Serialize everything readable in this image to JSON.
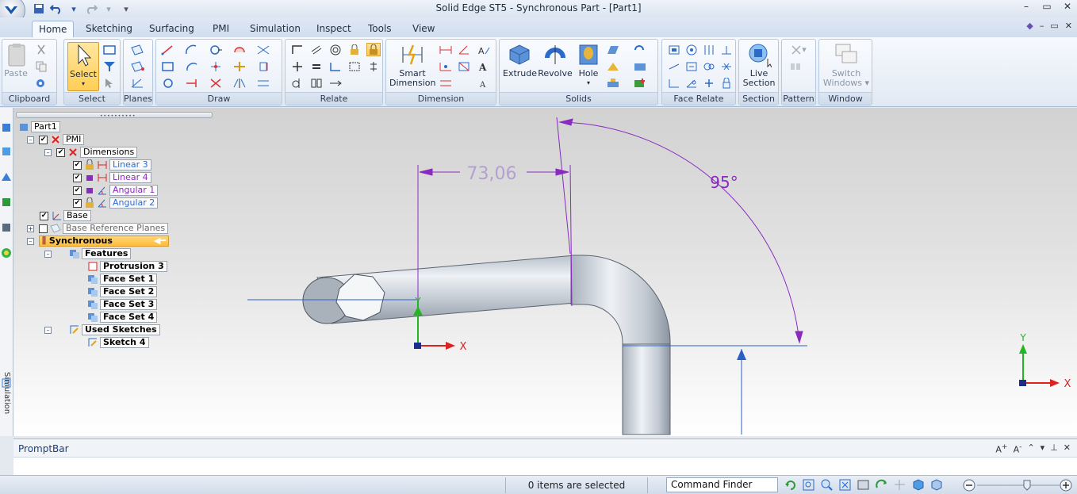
{
  "window": {
    "title": "Solid Edge ST5 - Synchronous Part - [Part1]"
  },
  "tabs": [
    {
      "label": "Home",
      "active": true
    },
    {
      "label": "Sketching"
    },
    {
      "label": "Surfacing"
    },
    {
      "label": "PMI"
    },
    {
      "label": "Simulation"
    },
    {
      "label": "Inspect"
    },
    {
      "label": "Tools"
    },
    {
      "label": "View"
    }
  ],
  "ribbon": {
    "clipboard": {
      "label": "Clipboard",
      "paste": "Paste"
    },
    "select": {
      "label": "Select",
      "select": "Select"
    },
    "planes": {
      "label": "Planes"
    },
    "draw": {
      "label": "Draw"
    },
    "relate": {
      "label": "Relate"
    },
    "dimension": {
      "label": "Dimension",
      "smart_1": "Smart",
      "smart_2": "Dimension"
    },
    "solids": {
      "label": "Solids",
      "extrude": "Extrude",
      "revolve": "Revolve",
      "hole": "Hole"
    },
    "face_relate": {
      "label": "Face Relate"
    },
    "section": {
      "label": "Section",
      "live_1": "Live",
      "live_2": "Section"
    },
    "pattern": {
      "label": "Pattern"
    },
    "window": {
      "label": "Window",
      "switch_1": "Switch",
      "switch_2": "Windows"
    }
  },
  "tree": {
    "part": "Part1",
    "pmi": "PMI",
    "dimensions": "Dimensions",
    "linear3": "Linear 3",
    "linear4": "Linear 4",
    "angular1": "Angular 1",
    "angular2": "Angular 2",
    "base": "Base",
    "base_ref": "Base Reference Planes",
    "synchronous": "Synchronous",
    "features": "Features",
    "protrusion3": "Protrusion 3",
    "faceset1": "Face Set 1",
    "faceset2": "Face Set 2",
    "faceset3": "Face Set 3",
    "faceset4": "Face Set 4",
    "used_sketches": "Used Sketches",
    "sketch4": "Sketch 4"
  },
  "left_toolbar": {
    "simulation": "Simulation"
  },
  "viewport": {
    "dimension_linear": "73,06",
    "dimension_angle": "95°",
    "axis_x": "X",
    "axis_y": "Y"
  },
  "promptbar": {
    "title": "PromptBar"
  },
  "status": {
    "selection": "0 items are selected",
    "command_finder": "Command Finder"
  },
  "colors": {
    "accent_blue": "#2b6bd6",
    "dimension_purple": "#8a2bbf",
    "selection_orange": "#ffbd3a"
  }
}
